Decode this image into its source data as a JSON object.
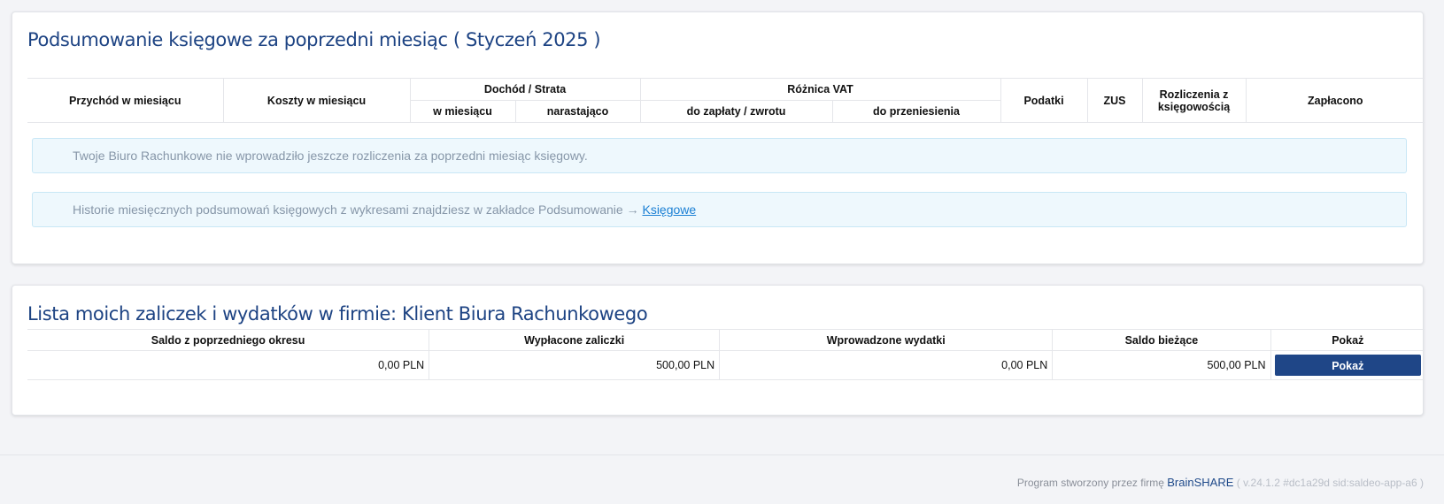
{
  "summary": {
    "title": "Podsumowanie księgowe za poprzedni miesiąc ( Styczeń 2025 )",
    "headers": {
      "income": "Przychód w miesiącu",
      "costs": "Koszty w miesiącu",
      "profit_loss": "Dochód / Strata",
      "profit_month": "w miesiącu",
      "profit_cumulative": "narastająco",
      "vat_difference": "Różnica VAT",
      "vat_to_pay": "do zapłaty / zwrotu",
      "vat_carry_over": "do przeniesienia",
      "taxes": "Podatki",
      "zus": "ZUS",
      "settlements_line1": "Rozliczenia z",
      "settlements_line2": "księgowością",
      "paid": "Zapłacono"
    },
    "alert_no_settlement": "Twoje Biuro Rachunkowe nie wprowadziło jeszcze rozliczenia za poprzedni miesiąc księgowy.",
    "alert_history_text": "Historie miesięcznych podsumowań księgowych z wykresami znajdziesz w zakładce Podsumowanie → ",
    "alert_history_link": "Księgowe"
  },
  "advances": {
    "title": "Lista moich zaliczek i wydatków w firmie: Klient Biura Rachunkowego",
    "headers": {
      "previous_balance": "Saldo z poprzedniego okresu",
      "advances_paid": "Wypłacone zaliczki",
      "expenses_entered": "Wprowadzone wydatki",
      "current_balance": "Saldo bieżące",
      "show": "Pokaż"
    },
    "row": {
      "previous_balance": "0,00 PLN",
      "advances_paid": "500,00 PLN",
      "expenses_entered": "0,00 PLN",
      "current_balance": "500,00 PLN",
      "show_button": "Pokaż"
    }
  },
  "footer": {
    "prefix": "Program stworzony przez firmę ",
    "brand": "BrainSHARE",
    "version": " ( v.24.1.2 #dc1a29d sid:saldeo-app-a6 )"
  },
  "colors": {
    "title": "#1d4383",
    "button": "#1f4687",
    "link": "#1a7fd4",
    "alert_bg": "#eef8fd"
  }
}
